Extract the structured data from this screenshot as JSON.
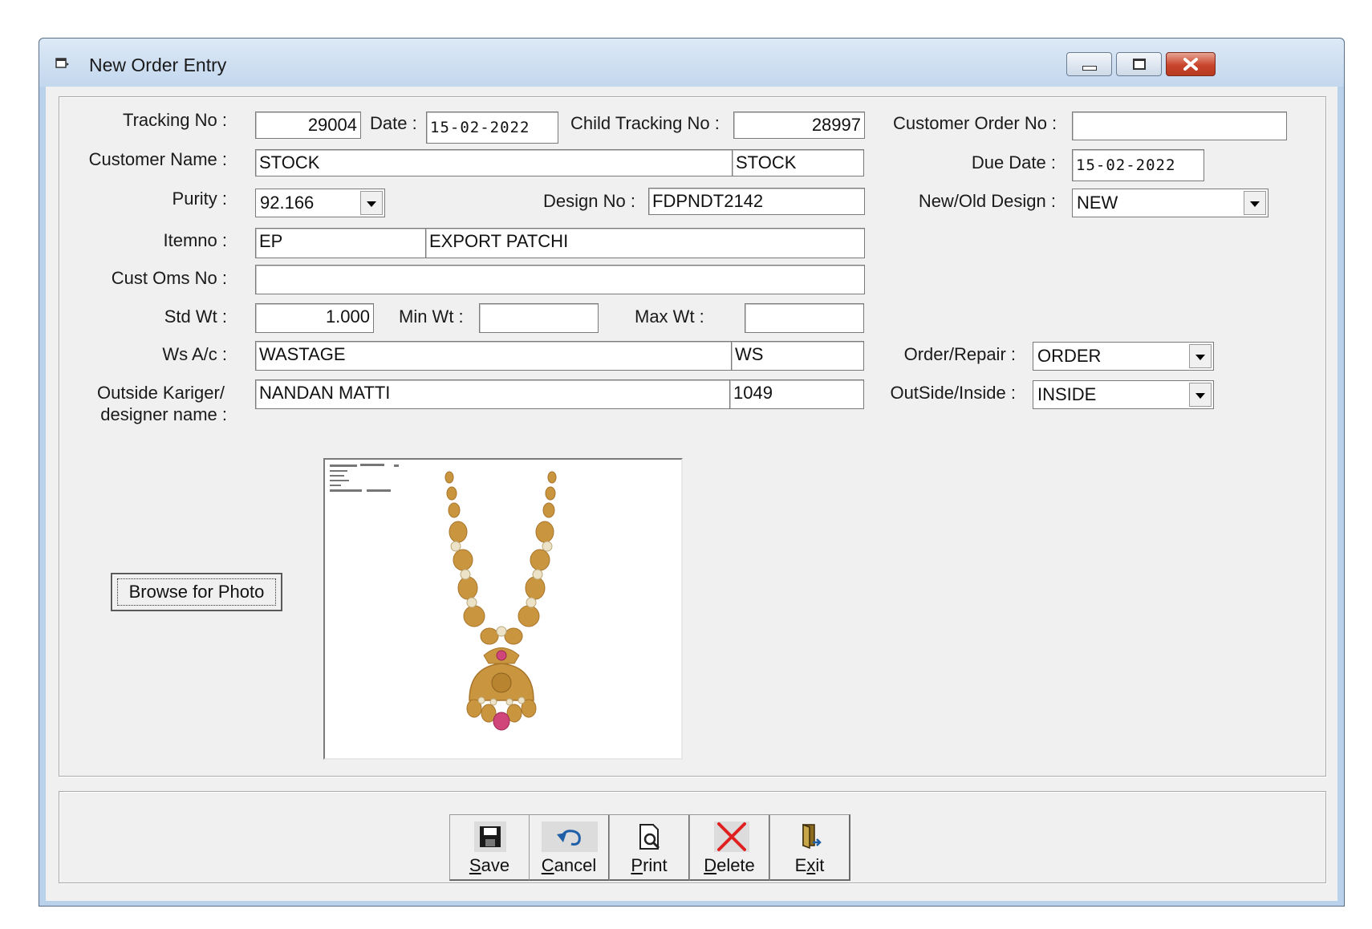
{
  "window": {
    "title": "New Order Entry",
    "controls": [
      "minimize-icon",
      "restore-icon",
      "close-icon"
    ]
  },
  "form": {
    "tracking_no": {
      "label": "Tracking No :",
      "value": "29004"
    },
    "date": {
      "label": "Date :",
      "value": "15-02-2022"
    },
    "child_tracking_no": {
      "label": "Child Tracking No :",
      "value": "28997"
    },
    "customer_order_no": {
      "label": "Customer Order No :",
      "value": ""
    },
    "customer_name": {
      "label": "Customer Name :",
      "value": "STOCK",
      "code": "STOCK"
    },
    "due_date": {
      "label": "Due Date :",
      "value": "15-02-2022"
    },
    "purity": {
      "label": "Purity :",
      "value": "92.166"
    },
    "design_no": {
      "label": "Design No :",
      "value": "FDPNDT2142"
    },
    "new_old_design": {
      "label": "New/Old  Design :",
      "value": "NEW"
    },
    "itemno": {
      "label": "Itemno :",
      "code": "EP",
      "value": "EXPORT PATCHI"
    },
    "cust_oms_no": {
      "label": "Cust Oms No :",
      "value": ""
    },
    "std_wt": {
      "label": "Std Wt :",
      "value": "1.000"
    },
    "min_wt": {
      "label": "Min Wt :",
      "value": ""
    },
    "max_wt": {
      "label": "Max Wt :",
      "value": ""
    },
    "ws_ac": {
      "label": "Ws A/c :",
      "value": "WASTAGE",
      "code": "WS"
    },
    "order_repair": {
      "label": "Order/Repair :",
      "value": "ORDER"
    },
    "outside_kariger": {
      "label_line1": "Outside Kariger/",
      "label_line2": "designer name :",
      "value": "NANDAN MATTI",
      "code": "1049"
    },
    "outside_inside": {
      "label": "OutSide/Inside :",
      "value": "INSIDE"
    },
    "browse_button": "Browse for Photo",
    "photo": {
      "subject": "gold necklace with pendant",
      "alt": "design photo"
    }
  },
  "toolbar": {
    "buttons": [
      {
        "id": "save",
        "label": "Save",
        "accel": "S",
        "rest": "ave",
        "icon": "floppy-disk-icon"
      },
      {
        "id": "cancel",
        "label": "Cancel",
        "accel": "C",
        "rest": "ancel",
        "icon": "undo-icon"
      },
      {
        "id": "print",
        "label": "Print",
        "accel": "P",
        "rest": "rint",
        "icon": "print-preview-icon"
      },
      {
        "id": "delete",
        "label": "Delete",
        "accel": "D",
        "rest": "elete",
        "icon": "red-x-icon"
      },
      {
        "id": "exit",
        "label": "Exit",
        "pre": "E",
        "accel": "x",
        "rest": "it",
        "icon": "exit-door-icon"
      }
    ]
  },
  "colors": {
    "window_frame": "#b9d1ea",
    "client_bg": "#f0f0f0",
    "close_button": "#c9442b",
    "delete_icon": "#e02020",
    "gold": "#c9963f",
    "pink_gem": "#d0457a"
  }
}
